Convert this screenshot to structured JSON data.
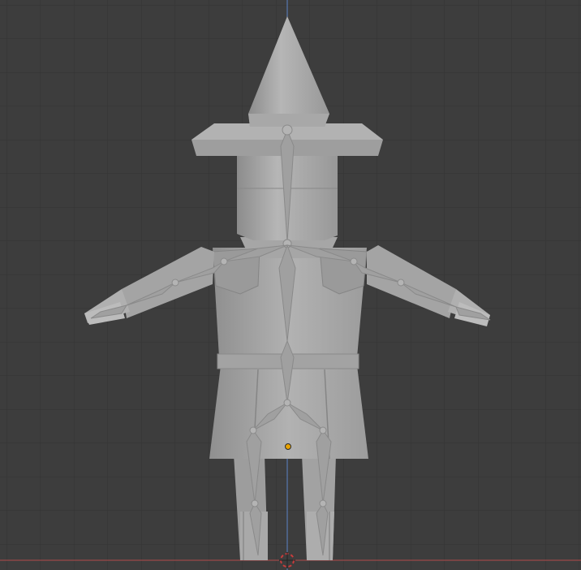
{
  "viewport": {
    "background": "#3d3d3d",
    "grid_color": "#333333",
    "z_axis_color": "#5a82c8",
    "x_axis_color": "#b44a4a",
    "origin_color": "#e8a200",
    "model_color": "#a8a8a8",
    "armature_color": "#9a9a9a"
  },
  "scene": {
    "object": "wizard-character",
    "armature": "bone-rig",
    "view": "front-orthographic"
  }
}
